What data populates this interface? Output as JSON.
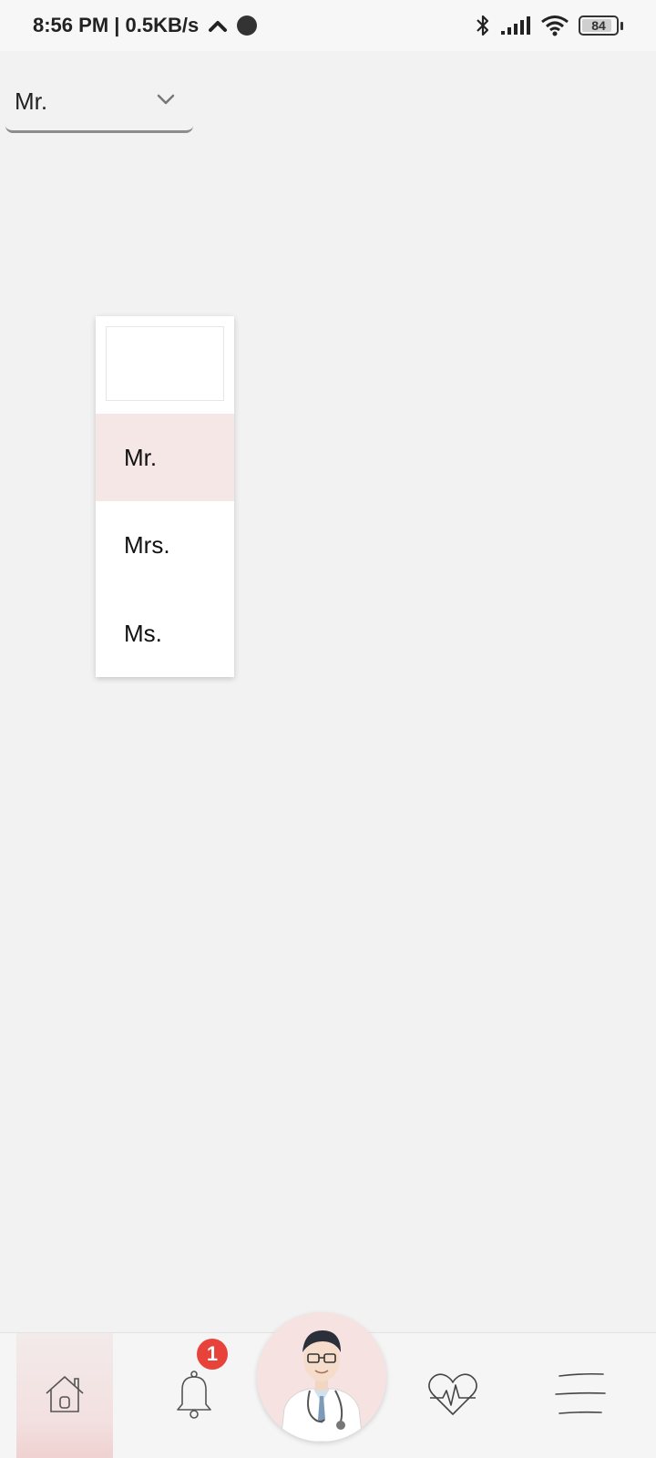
{
  "status_bar": {
    "time_speed": "8:56 PM | 0.5KB/s",
    "battery_level": "84",
    "icons": [
      "up-chevron-icon",
      "record-dot-icon",
      "bluetooth-icon",
      "signal-icon",
      "wifi-icon",
      "battery-icon"
    ]
  },
  "form": {
    "title_select": {
      "value": "Mr."
    }
  },
  "dropdown": {
    "options": [
      "Mr.",
      "Mrs.",
      "Ms."
    ],
    "selected_index": 0,
    "highlight_color": "#f6e7e7"
  },
  "bottom_nav": {
    "items": [
      "home-icon",
      "bell-icon",
      "doctor-avatar",
      "heart-pulse-icon",
      "menu-icon"
    ],
    "notification_count": "1",
    "active_item": "home",
    "badge_color": "#e8433a"
  }
}
